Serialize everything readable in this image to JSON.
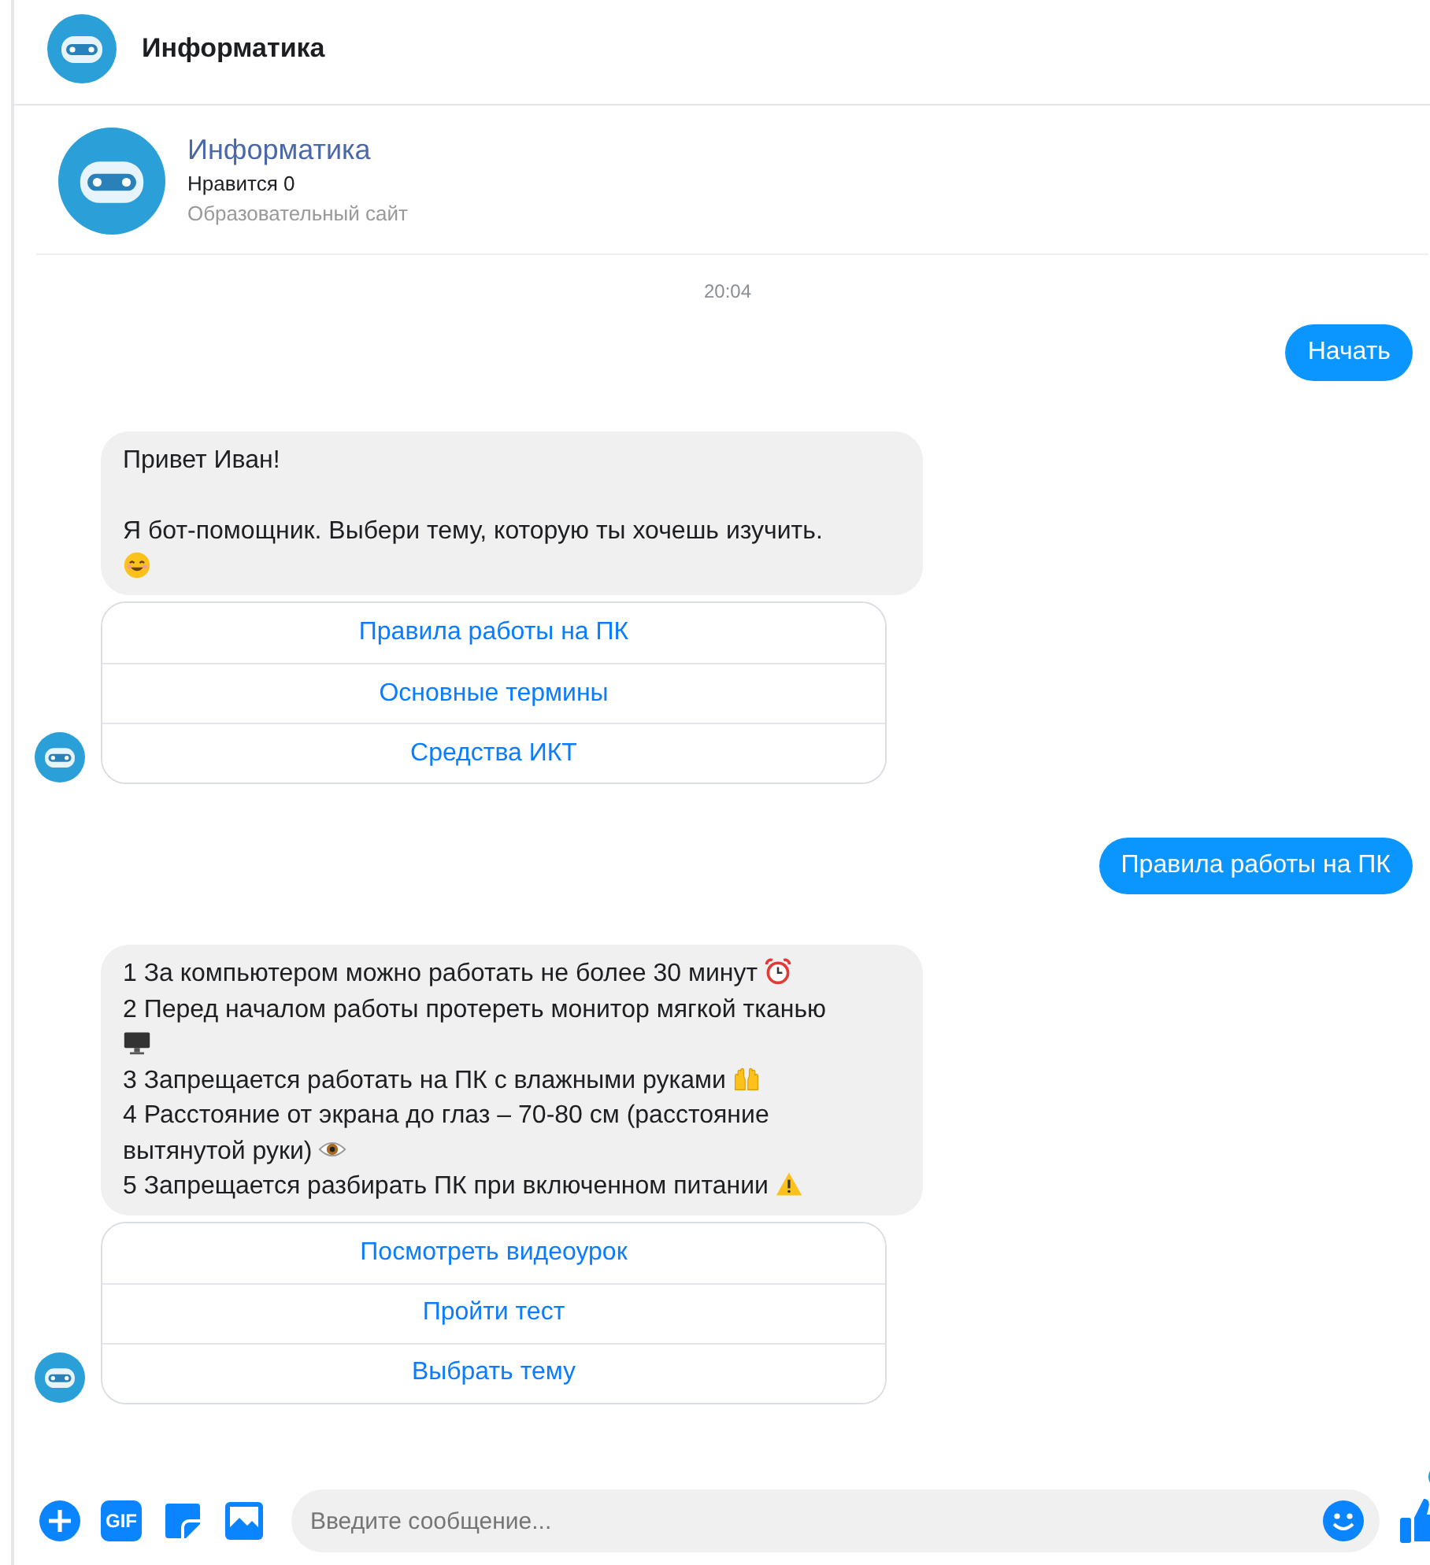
{
  "header": {
    "title": "Информатика"
  },
  "profile": {
    "name": "Информатика",
    "likes": "Нравится 0",
    "category": "Образовательный сайт"
  },
  "timestamp": "20:04",
  "messages": [
    {
      "kind": "user",
      "text": "Начать"
    },
    {
      "kind": "bot",
      "paragraphs": [
        {
          "lines": [
            {
              "kind": "text",
              "text": "Привет Иван!"
            }
          ]
        },
        {
          "lines": [
            {
              "kind": "text",
              "text": "Я бот-помощник. Выбери тему, которую ты хочешь изучить."
            },
            {
              "kind": "smile"
            }
          ]
        }
      ],
      "replies": [
        "Правила работы на ПК",
        "Основные термины",
        "Средства ИКТ"
      ]
    },
    {
      "kind": "user",
      "text": "Правила работы на ПК"
    },
    {
      "kind": "bot",
      "paragraphs": [
        {
          "lines": [
            {
              "kind": "clock",
              "text": "1 За компьютером можно работать не более 30 минут"
            },
            {
              "kind": "text",
              "text": "2 Перед началом работы протереть монитор мягкой тканью"
            },
            {
              "kind": "monitor"
            },
            {
              "kind": "hands",
              "text": "3 Запрещается работать на ПК с влажными руками"
            },
            {
              "kind": "text",
              "text": "4 Расстояние от экрана до глаз – 70-80 см (расстояние"
            },
            {
              "kind": "eye",
              "text": "вытянутой руки)"
            },
            {
              "kind": "warning",
              "text": "5 Запрещается разбирать ПК при включенном питании"
            }
          ]
        }
      ],
      "replies": [
        "Посмотреть видеоурок",
        "Пройти тест",
        "Выбрать тему"
      ]
    }
  ],
  "composer": {
    "gif": "GIF",
    "placeholder": "Введите сообщение..."
  }
}
